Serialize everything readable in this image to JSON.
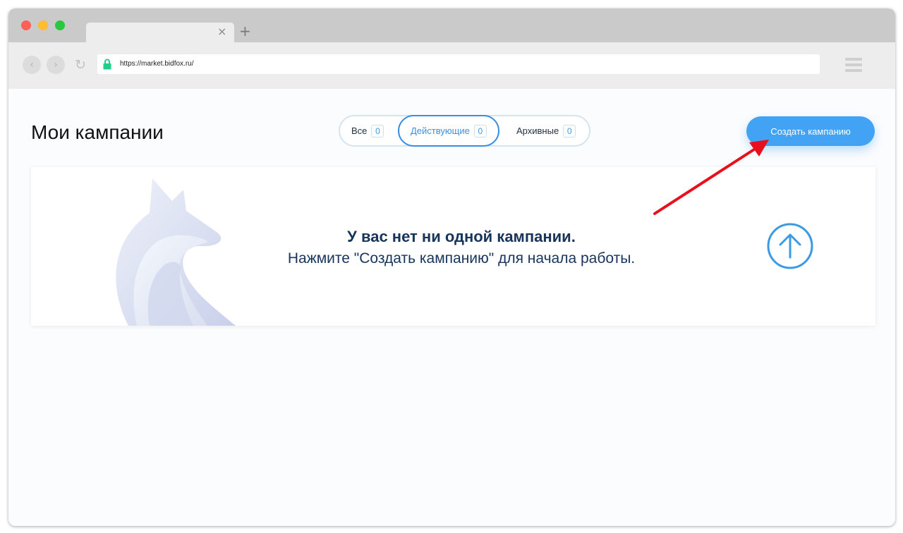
{
  "browser": {
    "url": "https://market.bidfox.ru/",
    "tab_close": "×",
    "new_tab": "+",
    "back": "‹",
    "forward": "›",
    "reload": "↻"
  },
  "page": {
    "title": "Мои кампании"
  },
  "filters": [
    {
      "label": "Все",
      "count": "0"
    },
    {
      "label": "Действующие",
      "count": "0",
      "active": true
    },
    {
      "label": "Архивные",
      "count": "0"
    }
  ],
  "actions": {
    "create_label": "Создать кампанию"
  },
  "empty_state": {
    "heading": "У вас нет ни одной кампании.",
    "text": "Нажмите \"Создать кампанию\" для начала работы."
  },
  "colors": {
    "accent": "#42a2f3",
    "heading": "#17345a",
    "annotation_arrow": "#e8101a"
  }
}
